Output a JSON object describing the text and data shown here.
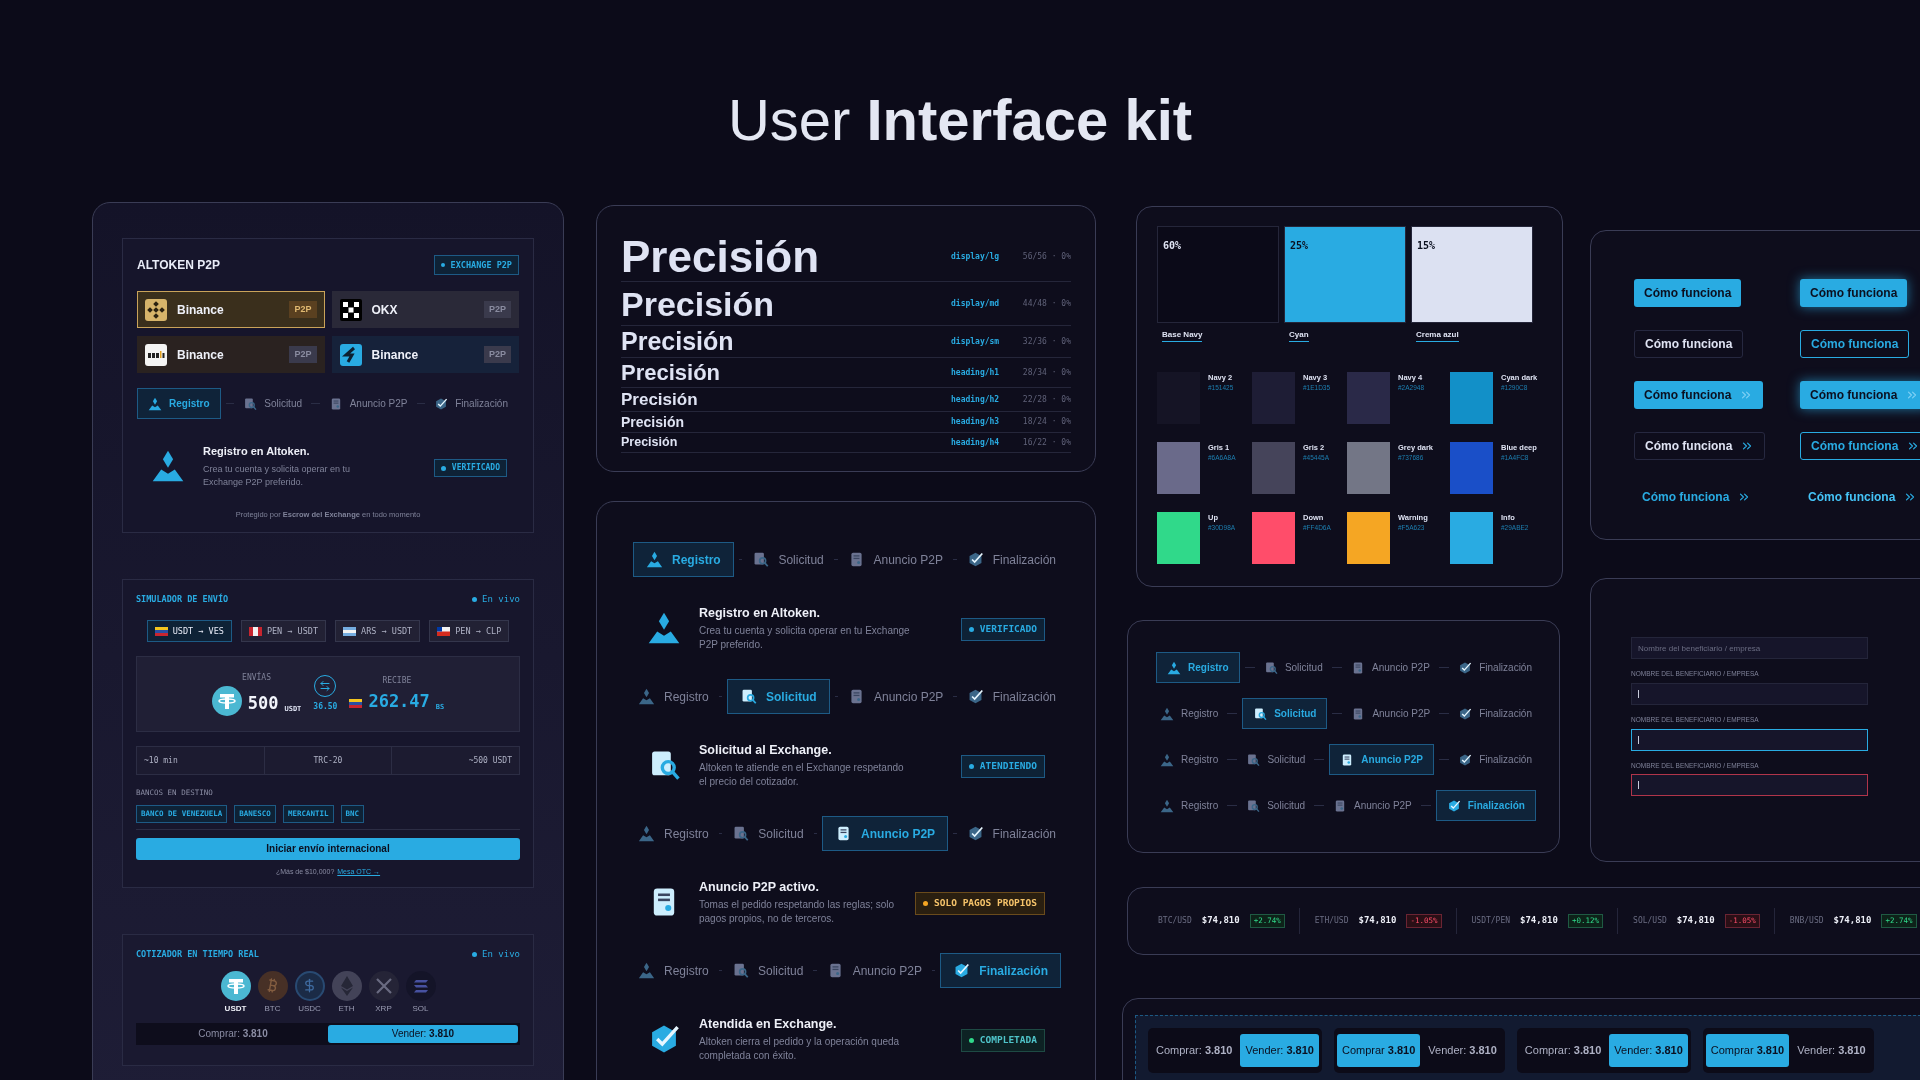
{
  "header": {
    "title": "User **Interface kit**"
  },
  "p2p_card": {
    "brand": "ALTOKEN **P2P**",
    "badge": "EXCHANGE P2P",
    "exchanges": [
      {
        "name": "Binance",
        "tag": "P2P",
        "selected": true,
        "kind": "binance",
        "color": "#3a2f1c"
      },
      {
        "name": "OKX",
        "tag": "P2P",
        "selected": false,
        "kind": "okx",
        "color": "#2a2938"
      },
      {
        "name": "Binance",
        "tag": "P2P",
        "selected": false,
        "kind": "bybit",
        "color": "#2a2220"
      },
      {
        "name": "Binance",
        "tag": "P2P",
        "selected": false,
        "kind": "bitget",
        "color": "#16223a"
      }
    ],
    "steps": [
      {
        "label": "Registro",
        "selected": true
      },
      {
        "label": "Solicitud",
        "selected": false
      },
      {
        "label": "Anuncio P2P",
        "selected": false
      },
      {
        "label": "Finalización",
        "selected": false
      }
    ],
    "detail": {
      "title": "Registro en Altoken.",
      "text": "Crea tu cuenta y solicita operar en tu Exchange P2P preferido.",
      "status": "VERIFICADO",
      "kind": "info"
    },
    "footer": "Protegido por **Escrow del Exchange** en todo momento"
  },
  "simulator": {
    "title": "SIMULADOR DE ENVÍO",
    "live": "En vivo",
    "pairs": [
      {
        "label": "USDT → VES",
        "kind": "ve",
        "selected": true
      },
      {
        "label": "PEN → USDT",
        "kind": "pe",
        "selected": false
      },
      {
        "label": "ARS → USDT",
        "kind": "ar",
        "selected": false
      },
      {
        "label": "PEN → CLP",
        "kind": "cl",
        "selected": false
      }
    ],
    "send": {
      "label": "ENVÍAS",
      "amount": "500",
      "unit": "USDT"
    },
    "rate": "36.50",
    "receive": {
      "label": "RECIBE",
      "amount": "262.47",
      "unit": "BS"
    },
    "stats": [
      "~10 min",
      "TRC-20",
      "~500 USDT"
    ],
    "banks_label": "BANCOS EN DESTINO",
    "banks": [
      "BANCO DE VENEZUELA",
      "BANESCO",
      "MERCANTIL",
      "BNC"
    ],
    "cta": "Iniciar envío internacional",
    "otc_text": "¿Más de $10,000?",
    "otc_link": "Mesa OTC →"
  },
  "quoter": {
    "title": "COTIZADOR EN TIEMPO REAL",
    "live": "En vivo",
    "coins": [
      {
        "symbol": "USDT",
        "kind": "usdt",
        "selected": true
      },
      {
        "symbol": "BTC",
        "kind": "btc",
        "selected": false
      },
      {
        "symbol": "USDC",
        "kind": "usdc",
        "selected": false
      },
      {
        "symbol": "ETH",
        "kind": "eth",
        "selected": false
      },
      {
        "symbol": "XRP",
        "kind": "xrp",
        "selected": false
      },
      {
        "symbol": "SOL",
        "kind": "sol",
        "selected": false
      }
    ],
    "sides": [
      {
        "label": "Comprar:",
        "value": "3.810",
        "selected": false
      },
      {
        "label": "Vender:",
        "value": "3.810",
        "selected": true
      }
    ]
  },
  "typography": {
    "rows": [
      {
        "sample": "Precisión",
        "token": "display/lg",
        "metrics": "56/56 · 0%"
      },
      {
        "sample": "Precisión",
        "token": "display/md",
        "metrics": "44/48 · 0%"
      },
      {
        "sample": "Precisión",
        "token": "display/sm",
        "metrics": "32/36 · 0%"
      },
      {
        "sample": "Precisión",
        "token": "heading/h1",
        "metrics": "28/34 · 0%"
      },
      {
        "sample": "Precisión",
        "token": "heading/h2",
        "metrics": "22/28 · 0%"
      },
      {
        "sample": "Precisión",
        "token": "heading/h3",
        "metrics": "18/24 · 0%"
      },
      {
        "sample": "Precisión",
        "token": "heading/h4",
        "metrics": "16/22 · 0%"
      }
    ]
  },
  "steps_card": {
    "blocks": [
      {
        "steps": [
          {
            "label": "Registro",
            "selected": true
          },
          {
            "label": "Solicitud",
            "selected": false
          },
          {
            "label": "Anuncio P2P",
            "selected": false
          },
          {
            "label": "Finalización",
            "selected": false
          }
        ],
        "detail": {
          "title": "Registro en Altoken.",
          "text": "Crea tu cuenta y solicita operar en tu Exchange P2P preferido.",
          "status": "VERIFICADO",
          "kind": "info"
        }
      },
      {
        "steps": [
          {
            "label": "Registro",
            "selected": false
          },
          {
            "label": "Solicitud",
            "selected": true
          },
          {
            "label": "Anuncio P2P",
            "selected": false
          },
          {
            "label": "Finalización",
            "selected": false
          }
        ],
        "detail": {
          "title": "Solicitud al Exchange.",
          "text": "Altoken te atiende en el Exchange respetando el precio del cotizador.",
          "status": "ATENDIENDO",
          "kind": "info"
        }
      },
      {
        "steps": [
          {
            "label": "Registro",
            "selected": false
          },
          {
            "label": "Solicitud",
            "selected": false
          },
          {
            "label": "Anuncio P2P",
            "selected": true
          },
          {
            "label": "Finalización",
            "selected": false
          }
        ],
        "detail": {
          "title": "Anuncio P2P activo.",
          "text": "Tomas el pedido respetando las reglas; solo pagos propios, no de terceros.",
          "status": "SOLO PAGOS PROPIOS",
          "kind": "warning"
        }
      },
      {
        "steps": [
          {
            "label": "Registro",
            "selected": false
          },
          {
            "label": "Solicitud",
            "selected": false
          },
          {
            "label": "Anuncio P2P",
            "selected": false
          },
          {
            "label": "Finalización",
            "selected": true
          }
        ],
        "detail": {
          "title": "Atendida en Exchange.",
          "text": "Altoken cierra el pedido y la operación queda completada con éxito.",
          "status": "COMPLETADA",
          "kind": "success"
        }
      }
    ]
  },
  "palette": {
    "primary": [
      {
        "share": "60%",
        "name": "Base Navy",
        "color": "#0b0a18"
      },
      {
        "share": "25%",
        "name": "Cyan",
        "color": "#29abe2"
      },
      {
        "share": "15%",
        "name": "Crema azul",
        "color": "#dce1f2"
      }
    ],
    "swatches": [
      {
        "name": "Navy 2",
        "hex": "#151425",
        "color": "#151425"
      },
      {
        "name": "Navy 3",
        "hex": "#1E1D35",
        "color": "#1e1d35"
      },
      {
        "name": "Navy 4",
        "hex": "#2A2948",
        "color": "#2a2948"
      },
      {
        "name": "Cyan dark",
        "hex": "#1290C8",
        "color": "#1290c8"
      },
      {
        "name": "Gris 1",
        "hex": "#6A6A8A",
        "color": "#6a6a8a"
      },
      {
        "name": "Gris 2",
        "hex": "#45445A",
        "color": "#45445a"
      },
      {
        "name": "Grey dark",
        "hex": "#737686",
        "color": "#737686"
      },
      {
        "name": "Blue deep",
        "hex": "#1A4FC8",
        "color": "#1a4fc8"
      },
      {
        "name": "Up",
        "hex": "#30D98A",
        "color": "#30d98a"
      },
      {
        "name": "Down",
        "hex": "#FF4D6A",
        "color": "#ff4d6a"
      },
      {
        "name": "Warning",
        "hex": "#F5A623",
        "color": "#f5a623"
      },
      {
        "name": "Info",
        "hex": "#29ABE2",
        "color": "#29abe2"
      }
    ]
  },
  "compact_steppers": {
    "rows": [
      {
        "steps": [
          {
            "label": "Registro",
            "selected": true
          },
          {
            "label": "Solicitud",
            "selected": false
          },
          {
            "label": "Anuncio P2P",
            "selected": false
          },
          {
            "label": "Finalización",
            "selected": false
          }
        ]
      },
      {
        "steps": [
          {
            "label": "Registro",
            "selected": false
          },
          {
            "label": "Solicitud",
            "selected": true
          },
          {
            "label": "Anuncio P2P",
            "selected": false
          },
          {
            "label": "Finalización",
            "selected": false
          }
        ]
      },
      {
        "steps": [
          {
            "label": "Registro",
            "selected": false
          },
          {
            "label": "Solicitud",
            "selected": false
          },
          {
            "label": "Anuncio P2P",
            "selected": true
          },
          {
            "label": "Finalización",
            "selected": false
          }
        ]
      },
      {
        "steps": [
          {
            "label": "Registro",
            "selected": false
          },
          {
            "label": "Solicitud",
            "selected": false
          },
          {
            "label": "Anuncio P2P",
            "selected": false
          },
          {
            "label": "Finalización",
            "selected": true
          }
        ]
      }
    ]
  },
  "buttons": {
    "items": [
      {
        "label": "Cómo funciona",
        "kind": "primary",
        "hover": false,
        "arrow": false
      },
      {
        "label": "Cómo funciona",
        "kind": "primary",
        "hover": true,
        "arrow": false
      },
      {
        "label": "Cómo funciona",
        "kind": "secondary",
        "hover": false,
        "arrow": false
      },
      {
        "label": "Cómo funciona",
        "kind": "secondary",
        "hover": true,
        "arrow": false
      },
      {
        "label": "Cómo funciona",
        "kind": "primary",
        "hover": false,
        "arrow": true
      },
      {
        "label": "Cómo funciona",
        "kind": "primary",
        "hover": true,
        "arrow": true
      },
      {
        "label": "Cómo funciona",
        "kind": "secondary",
        "hover": false,
        "arrow": true
      },
      {
        "label": "Cómo funciona",
        "kind": "secondary",
        "hover": true,
        "arrow": true
      },
      {
        "label": "Cómo funciona",
        "kind": "link",
        "hover": false,
        "arrow": true
      },
      {
        "label": "Cómo funciona",
        "kind": "link",
        "hover": true,
        "arrow": true
      }
    ]
  },
  "form": {
    "placeholder": "Nombre del beneficiario / empresa",
    "fields": [
      {
        "label": "NOMBRE DEL BENEFICIARIO / EMPRESA",
        "focused": false,
        "invalid": false
      },
      {
        "label": "NOMBRE DEL BENEFICIARIO / EMPRESA",
        "focused": true,
        "invalid": false
      },
      {
        "label": "NOMBRE DEL BENEFICIARIO / EMPRESA",
        "focused": false,
        "invalid": true
      }
    ]
  },
  "ticker": {
    "items": [
      {
        "pair": "BTC/USD",
        "price": "$74,810",
        "change": "+2.74%",
        "up": true
      },
      {
        "pair": "ETH/USD",
        "price": "$74,810",
        "change": "-1.05%",
        "up": false
      },
      {
        "pair": "USDT/PEN",
        "price": "$74,810",
        "change": "+0.12%",
        "up": true
      },
      {
        "pair": "SOL/USD",
        "price": "$74,810",
        "change": "-1.05%",
        "up": false
      },
      {
        "pair": "BNB/USD",
        "price": "$74,810",
        "change": "+2.74%",
        "up": true
      }
    ]
  },
  "quotes_bar": {
    "groups": [
      {
        "options": [
          {
            "label": "Comprar:",
            "value": "3.810",
            "selected": false
          },
          {
            "label": "Vender:",
            "value": "3.810",
            "selected": true
          }
        ]
      },
      {
        "options": [
          {
            "label": "Comprar",
            "value": "3.810",
            "selected": true
          },
          {
            "label": "Vender:",
            "value": "3.810",
            "selected": false
          }
        ]
      },
      {
        "options": [
          {
            "label": "Comprar:",
            "value": "3.810",
            "selected": false
          },
          {
            "label": "Vender:",
            "value": "3.810",
            "selected": true
          }
        ]
      },
      {
        "options": [
          {
            "label": "Comprar",
            "value": "3.810",
            "selected": true
          },
          {
            "label": "Vender:",
            "value": "3.810",
            "selected": false
          }
        ]
      }
    ]
  }
}
